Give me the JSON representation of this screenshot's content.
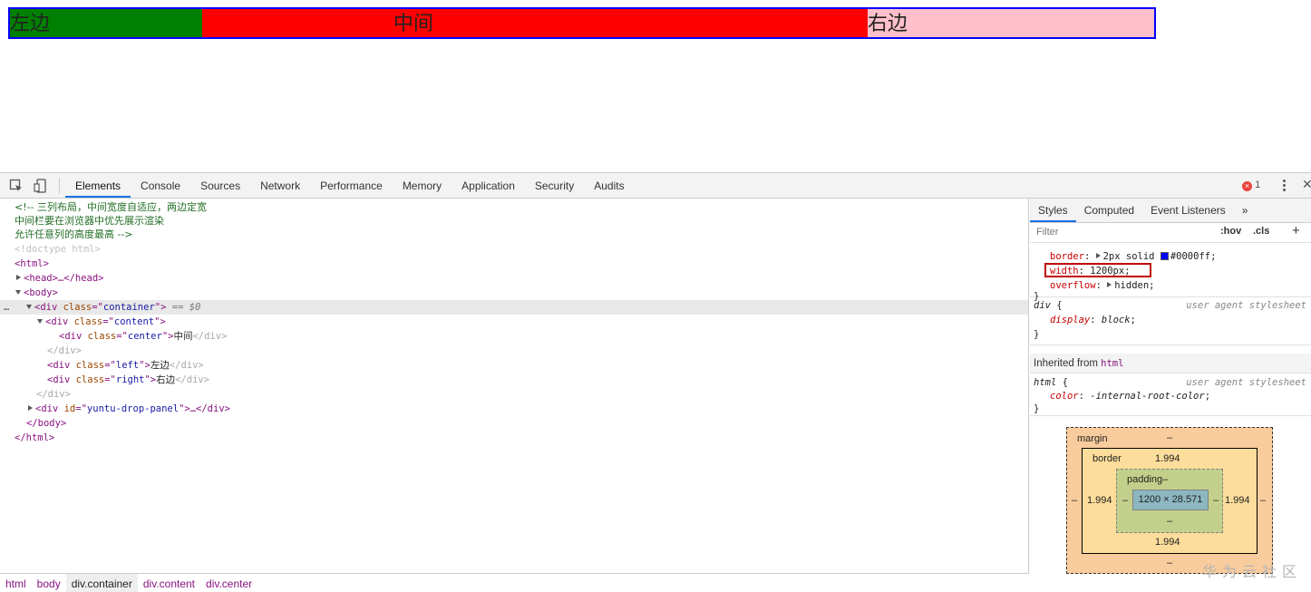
{
  "viewport": {
    "left": "左边",
    "center": "中间",
    "right": "右边"
  },
  "devtools": {
    "tabs": [
      "Elements",
      "Console",
      "Sources",
      "Network",
      "Performance",
      "Memory",
      "Application",
      "Security",
      "Audits"
    ],
    "active_tab": "Elements",
    "error_count": "1",
    "elements_lines": {
      "c1": "<!-- 三列布局，中间宽度自适应，两边定宽",
      "c2": "中间栏要在浏览器中优先展示渲染",
      "c3": "允许任意列的高度最高 -->",
      "doctype": "<!doctype html>",
      "html": "<html>",
      "head": "<head>…</head>",
      "body": "<body>",
      "container_class": "container",
      "container_suffix": " == $0",
      "content_class": "content",
      "center_class": "center",
      "center_text": "中间",
      "left_class": "left",
      "left_text": "左边",
      "right_class": "right",
      "right_text": "右边",
      "panel_id": "yuntu-drop-panel",
      "ellipsis": "…"
    },
    "breadcrumb": [
      "html",
      "body",
      "div.container",
      "div.content",
      "div.center"
    ],
    "styles": {
      "tabs": [
        "Styles",
        "Computed",
        "Event Listeners",
        "»"
      ],
      "filter_placeholder": "Filter",
      "hov": ":hov",
      "cls": ".cls",
      "plus": "+",
      "rule1": {
        "border_name": "border",
        "border_value": "2px solid",
        "border_color": "#0000ff",
        "width_name": "width",
        "width_value": "1200px",
        "overflow_name": "overflow",
        "overflow_value": "hidden"
      },
      "rule2": {
        "selector": "div",
        "origin": "user agent stylesheet",
        "prop": "display",
        "value": "block"
      },
      "inherited_label": "Inherited from",
      "inherited_el": "html",
      "rule3": {
        "selector": "html",
        "origin": "user agent stylesheet",
        "prop": "color",
        "value": "-internal-root-color"
      }
    },
    "box_model": {
      "margin_label": "margin",
      "margin_value": "–",
      "border_label": "border",
      "border_value": "1.994",
      "padding_label": "padding–",
      "padding_value": "–",
      "content": "1200 × 28.571"
    }
  },
  "watermark": "华为云社区"
}
